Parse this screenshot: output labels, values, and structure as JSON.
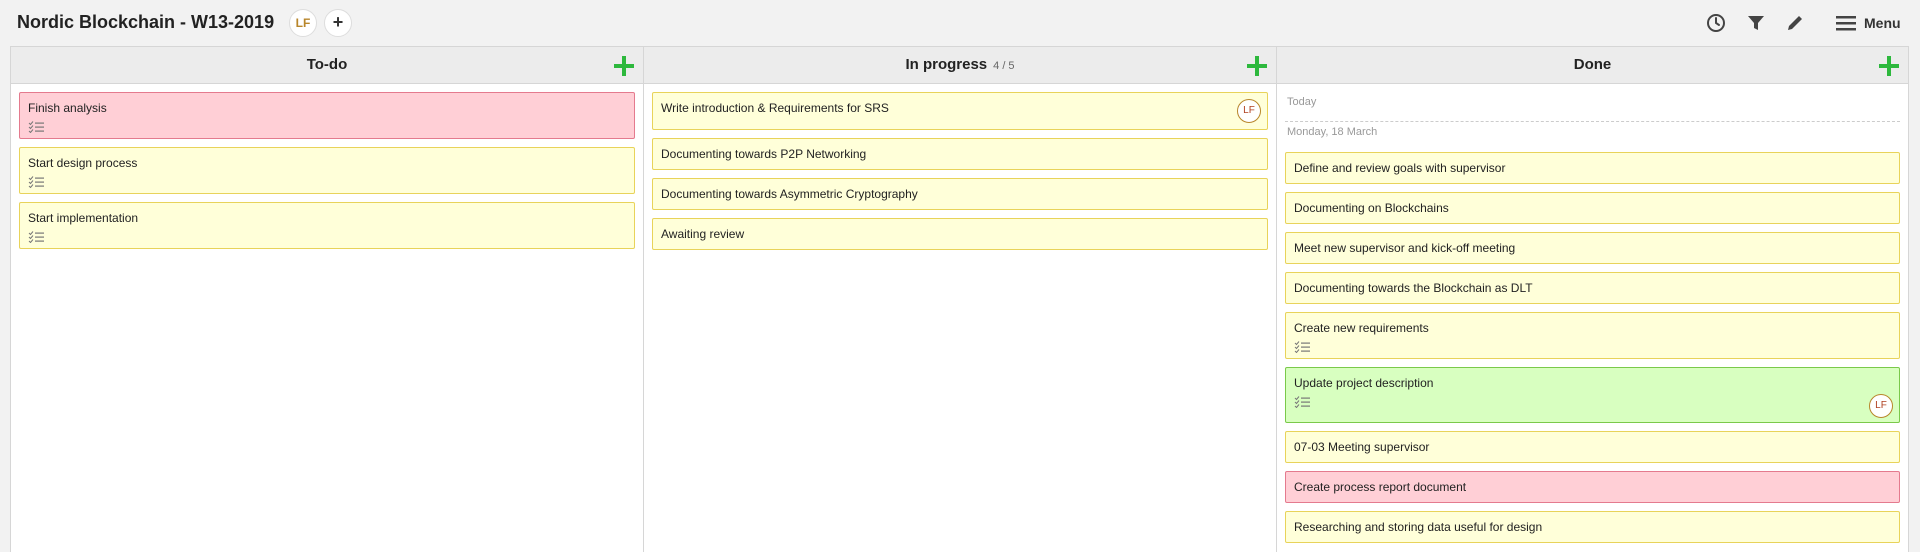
{
  "board": {
    "title": "Nordic Blockchain - W13-2019",
    "member_initials": "LF",
    "add_member": "+"
  },
  "toolbar": {
    "menu_label": "Menu"
  },
  "columns": [
    {
      "title": "To-do",
      "cards": [
        {
          "text": "Finish analysis",
          "color": "#ffcfd6",
          "checklist": true
        },
        {
          "text": "Start design process",
          "color": "#ffffd9",
          "checklist": true
        },
        {
          "text": "Start implementation",
          "color": "#ffffd9",
          "checklist": true
        }
      ]
    },
    {
      "title": "In progress",
      "wip": "4 / 5",
      "cards": [
        {
          "text": "Write introduction & Requirements for SRS",
          "assignee": "LF"
        },
        {
          "text": "Documenting towards P2P Networking"
        },
        {
          "text": "Documenting towards Asymmetric Cryptography"
        },
        {
          "text": "Awaiting review"
        }
      ]
    },
    {
      "title": "Done",
      "sections": [
        {
          "label": "Today"
        },
        {
          "label": "Monday, 18 March"
        }
      ],
      "cards": [
        {
          "text": "Define and review goals with supervisor"
        },
        {
          "text": "Documenting on Blockchains"
        },
        {
          "text": "Meet new supervisor and kick-off meeting"
        },
        {
          "text": "Documenting towards the Blockchain as DLT"
        },
        {
          "text": "Create new requirements",
          "checklist": true
        },
        {
          "text": "Update project description",
          "color": "#d8ffc0",
          "checklist": true,
          "assignee": "LF"
        },
        {
          "text": "07-03 Meeting supervisor"
        },
        {
          "text": "Create process report document",
          "color": "#ffcfd6"
        },
        {
          "text": "Researching and storing data useful for design"
        }
      ]
    }
  ],
  "colors": {
    "card_yellow": "#ffffd9",
    "card_pink": "#ffcfd6",
    "card_green": "#d8ffc0",
    "add_green": "#2db83d"
  },
  "icons": [
    "history-icon",
    "filter-icon",
    "pencil-icon",
    "hamburger-icon",
    "plus-icon",
    "checklist-icon"
  ]
}
